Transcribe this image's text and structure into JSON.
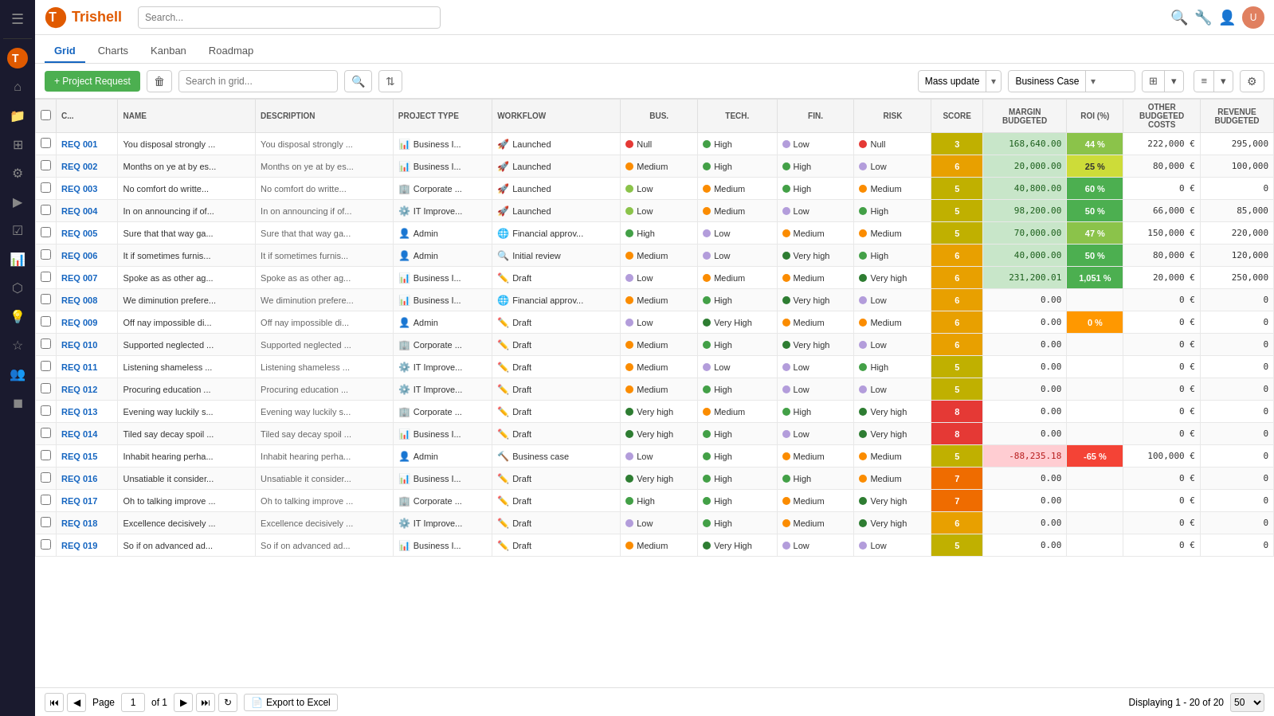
{
  "app": {
    "name": "Trishell"
  },
  "topbar": {
    "search_placeholder": "Search...",
    "icons": [
      "search",
      "wrench",
      "users",
      "avatar"
    ]
  },
  "nav": {
    "tabs": [
      "Grid",
      "Charts",
      "Kanban",
      "Roadmap"
    ],
    "active": "Grid"
  },
  "toolbar": {
    "add_label": "+ Project Request",
    "search_placeholder": "Search in grid...",
    "mass_update_label": "Mass update",
    "business_case_label": "Business Case",
    "export_label": "Export to Excel"
  },
  "columns": {
    "headers": [
      "",
      "C...",
      "NAME",
      "DESCRIPTION",
      "PROJECT TYPE",
      "WORKFLOW",
      "BUS.",
      "TECH.",
      "FIN.",
      "RISK",
      "SCORE",
      "MARGIN BUDGETED",
      "ROI (%)",
      "OTHER BUDGETED COSTS",
      "REVENUE BUDGETED"
    ]
  },
  "rows": [
    {
      "id": "REQ 001",
      "name": "You disposal strongly ...",
      "desc": "You disposal strongly ...",
      "type": "Business I...",
      "typeIcon": "📊",
      "workflow": "Launched",
      "workflowIcon": "🚀",
      "bus": "Null",
      "busDot": "red",
      "tech": "High",
      "techDot": "green",
      "fin": "Low",
      "finDot": "lavender",
      "risk": "Null",
      "riskDot": "red",
      "score": 3,
      "margin": "168,640.00",
      "marginClass": "margin-pos",
      "roi": "44 %",
      "roiClass": "roi-pos-med",
      "budget": "222,000 €",
      "revenue": "295,000"
    },
    {
      "id": "REQ 002",
      "name": "Months on ye at by es...",
      "desc": "Months on ye at by es...",
      "type": "Business I...",
      "typeIcon": "📊",
      "workflow": "Launched",
      "workflowIcon": "🚀",
      "bus": "Medium",
      "busDot": "orange",
      "tech": "High",
      "techDot": "green",
      "fin": "High",
      "finDot": "green",
      "risk": "Low",
      "riskDot": "lavender",
      "score": 6,
      "margin": "20,000.00",
      "marginClass": "margin-pos",
      "roi": "25 %",
      "roiClass": "roi-pos-low",
      "budget": "80,000 €",
      "revenue": "100,000"
    },
    {
      "id": "REQ 003",
      "name": "No comfort do writte...",
      "desc": "No comfort do writte...",
      "type": "Corporate ...",
      "typeIcon": "🏢",
      "workflow": "Launched",
      "workflowIcon": "🚀",
      "bus": "Low",
      "busDot": "lightgreen",
      "tech": "Medium",
      "techDot": "orange",
      "fin": "High",
      "finDot": "green",
      "risk": "Medium",
      "riskDot": "orange",
      "score": 5,
      "margin": "40,800.00",
      "marginClass": "margin-pos",
      "roi": "60 %",
      "roiClass": "roi-pos-high",
      "budget": "0 €",
      "revenue": "0"
    },
    {
      "id": "REQ 004",
      "name": "In on announcing if of...",
      "desc": "In on announcing if of...",
      "type": "IT Improve...",
      "typeIcon": "⚙️",
      "workflow": "Launched",
      "workflowIcon": "🚀",
      "bus": "Low",
      "busDot": "lightgreen",
      "tech": "Medium",
      "techDot": "orange",
      "fin": "Low",
      "finDot": "lavender",
      "risk": "High",
      "riskDot": "green",
      "score": 5,
      "margin": "98,200.00",
      "marginClass": "margin-pos",
      "roi": "50 %",
      "roiClass": "roi-pos-high",
      "budget": "66,000 €",
      "revenue": "85,000"
    },
    {
      "id": "REQ 005",
      "name": "Sure that that way ga...",
      "desc": "Sure that that way ga...",
      "type": "Admin",
      "typeIcon": "👤",
      "workflow": "Financial approv...",
      "workflowIcon": "🌐",
      "bus": "High",
      "busDot": "green",
      "tech": "Low",
      "techDot": "lavender",
      "fin": "Medium",
      "finDot": "orange",
      "risk": "Medium",
      "riskDot": "orange",
      "score": 5,
      "margin": "70,000.00",
      "marginClass": "margin-pos",
      "roi": "47 %",
      "roiClass": "roi-pos-med",
      "budget": "150,000 €",
      "revenue": "220,000"
    },
    {
      "id": "REQ 006",
      "name": "It if sometimes furnis...",
      "desc": "It if sometimes furnis...",
      "type": "Admin",
      "typeIcon": "👤",
      "workflow": "Initial review",
      "workflowIcon": "🔍",
      "bus": "Medium",
      "busDot": "orange",
      "tech": "Low",
      "techDot": "lavender",
      "fin": "Very high",
      "finDot": "darkgreen",
      "risk": "High",
      "riskDot": "green",
      "score": 6,
      "margin": "40,000.00",
      "marginClass": "margin-pos",
      "roi": "50 %",
      "roiClass": "roi-pos-high",
      "budget": "80,000 €",
      "revenue": "120,000"
    },
    {
      "id": "REQ 007",
      "name": "Spoke as as other ag...",
      "desc": "Spoke as as other ag...",
      "type": "Business I...",
      "typeIcon": "📊",
      "workflow": "Draft",
      "workflowIcon": "✏️",
      "bus": "Low",
      "busDot": "lavender",
      "tech": "Medium",
      "techDot": "orange",
      "fin": "Medium",
      "finDot": "orange",
      "risk": "Very high",
      "riskDot": "darkgreen",
      "score": 6,
      "margin": "231,200.01",
      "marginClass": "margin-pos",
      "roi": "1,051 %",
      "roiClass": "roi-pos-high",
      "budget": "20,000 €",
      "revenue": "250,000"
    },
    {
      "id": "REQ 008",
      "name": "We diminution prefere...",
      "desc": "We diminution prefere...",
      "type": "Business I...",
      "typeIcon": "📊",
      "workflow": "Financial approv...",
      "workflowIcon": "🌐",
      "bus": "Medium",
      "busDot": "orange",
      "tech": "High",
      "techDot": "green",
      "fin": "Very high",
      "finDot": "darkgreen",
      "risk": "Low",
      "riskDot": "lavender",
      "score": 6,
      "margin": "0.00",
      "marginClass": "",
      "roi": "",
      "roiClass": "",
      "budget": "0 €",
      "revenue": "0"
    },
    {
      "id": "REQ 009",
      "name": "Off nay impossible di...",
      "desc": "Off nay impossible di...",
      "type": "Admin",
      "typeIcon": "👤",
      "workflow": "Draft",
      "workflowIcon": "✏️",
      "bus": "Low",
      "busDot": "lavender",
      "tech": "Very High",
      "techDot": "darkgreen",
      "fin": "Medium",
      "finDot": "orange",
      "risk": "Medium",
      "riskDot": "orange",
      "score": 6,
      "margin": "0.00",
      "marginClass": "",
      "roi": "0 %",
      "roiClass": "roi-zero",
      "budget": "0 €",
      "revenue": "0"
    },
    {
      "id": "REQ 010",
      "name": "Supported neglected ...",
      "desc": "Supported neglected ...",
      "type": "Corporate ...",
      "typeIcon": "🏢",
      "workflow": "Draft",
      "workflowIcon": "✏️",
      "bus": "Medium",
      "busDot": "orange",
      "tech": "High",
      "techDot": "green",
      "fin": "Very high",
      "finDot": "darkgreen",
      "risk": "Low",
      "riskDot": "lavender",
      "score": 6,
      "margin": "0.00",
      "marginClass": "",
      "roi": "",
      "roiClass": "",
      "budget": "0 €",
      "revenue": "0"
    },
    {
      "id": "REQ 011",
      "name": "Listening shameless ...",
      "desc": "Listening shameless ...",
      "type": "IT Improve...",
      "typeIcon": "⚙️",
      "workflow": "Draft",
      "workflowIcon": "✏️",
      "bus": "Medium",
      "busDot": "orange",
      "tech": "Low",
      "techDot": "lavender",
      "fin": "Low",
      "finDot": "lavender",
      "risk": "High",
      "riskDot": "green",
      "score": 5,
      "margin": "0.00",
      "marginClass": "",
      "roi": "",
      "roiClass": "",
      "budget": "0 €",
      "revenue": "0"
    },
    {
      "id": "REQ 012",
      "name": "Procuring education ...",
      "desc": "Procuring education ...",
      "type": "IT Improve...",
      "typeIcon": "⚙️",
      "workflow": "Draft",
      "workflowIcon": "✏️",
      "bus": "Medium",
      "busDot": "orange",
      "tech": "High",
      "techDot": "green",
      "fin": "Low",
      "finDot": "lavender",
      "risk": "Low",
      "riskDot": "lavender",
      "score": 5,
      "margin": "0.00",
      "marginClass": "",
      "roi": "",
      "roiClass": "",
      "budget": "0 €",
      "revenue": "0"
    },
    {
      "id": "REQ 013",
      "name": "Evening way luckily s...",
      "desc": "Evening way luckily s...",
      "type": "Corporate ...",
      "typeIcon": "🏢",
      "workflow": "Draft",
      "workflowIcon": "✏️",
      "bus": "Very high",
      "busDot": "darkgreen",
      "tech": "Medium",
      "techDot": "orange",
      "fin": "High",
      "finDot": "green",
      "risk": "Very high",
      "riskDot": "darkgreen",
      "score": 8,
      "margin": "0.00",
      "marginClass": "",
      "roi": "",
      "roiClass": "",
      "budget": "0 €",
      "revenue": "0"
    },
    {
      "id": "REQ 014",
      "name": "Tiled say decay spoil ...",
      "desc": "Tiled say decay spoil ...",
      "type": "Business I...",
      "typeIcon": "📊",
      "workflow": "Draft",
      "workflowIcon": "✏️",
      "bus": "Very high",
      "busDot": "darkgreen",
      "tech": "High",
      "techDot": "green",
      "fin": "Low",
      "finDot": "lavender",
      "risk": "Very high",
      "riskDot": "darkgreen",
      "score": 8,
      "margin": "0.00",
      "marginClass": "",
      "roi": "",
      "roiClass": "",
      "budget": "0 €",
      "revenue": "0"
    },
    {
      "id": "REQ 015",
      "name": "Inhabit hearing perha...",
      "desc": "Inhabit hearing perha...",
      "type": "Admin",
      "typeIcon": "👤",
      "workflow": "Business case",
      "workflowIcon": "🔨",
      "bus": "Low",
      "busDot": "lavender",
      "tech": "High",
      "techDot": "green",
      "fin": "Medium",
      "finDot": "orange",
      "risk": "Medium",
      "riskDot": "orange",
      "score": 5,
      "margin": "-88,235.18",
      "marginClass": "margin-neg",
      "roi": "-65 %",
      "roiClass": "roi-neg",
      "budget": "100,000 €",
      "revenue": "0"
    },
    {
      "id": "REQ 016",
      "name": "Unsatiable it consider...",
      "desc": "Unsatiable it consider...",
      "type": "Business I...",
      "typeIcon": "📊",
      "workflow": "Draft",
      "workflowIcon": "✏️",
      "bus": "Very high",
      "busDot": "darkgreen",
      "tech": "High",
      "techDot": "green",
      "fin": "High",
      "finDot": "green",
      "risk": "Medium",
      "riskDot": "orange",
      "score": 7,
      "margin": "0.00",
      "marginClass": "",
      "roi": "",
      "roiClass": "",
      "budget": "0 €",
      "revenue": "0"
    },
    {
      "id": "REQ 017",
      "name": "Oh to talking improve ...",
      "desc": "Oh to talking improve ...",
      "type": "Corporate ...",
      "typeIcon": "🏢",
      "workflow": "Draft",
      "workflowIcon": "✏️",
      "bus": "High",
      "busDot": "green",
      "tech": "High",
      "techDot": "green",
      "fin": "Medium",
      "finDot": "orange",
      "risk": "Very high",
      "riskDot": "darkgreen",
      "score": 7,
      "margin": "0.00",
      "marginClass": "",
      "roi": "",
      "roiClass": "",
      "budget": "0 €",
      "revenue": "0"
    },
    {
      "id": "REQ 018",
      "name": "Excellence decisively ...",
      "desc": "Excellence decisively ...",
      "type": "IT Improve...",
      "typeIcon": "⚙️",
      "workflow": "Draft",
      "workflowIcon": "✏️",
      "bus": "Low",
      "busDot": "lavender",
      "tech": "High",
      "techDot": "green",
      "fin": "Medium",
      "finDot": "orange",
      "risk": "Very high",
      "riskDot": "darkgreen",
      "score": 6,
      "margin": "0.00",
      "marginClass": "",
      "roi": "",
      "roiClass": "",
      "budget": "0 €",
      "revenue": "0"
    },
    {
      "id": "REQ 019",
      "name": "So if on advanced ad...",
      "desc": "So if on advanced ad...",
      "type": "Business I...",
      "typeIcon": "📊",
      "workflow": "Draft",
      "workflowIcon": "✏️",
      "bus": "Medium",
      "busDot": "orange",
      "tech": "Very High",
      "techDot": "darkgreen",
      "fin": "Low",
      "finDot": "lavender",
      "risk": "Low",
      "riskDot": "lavender",
      "score": 5,
      "margin": "0.00",
      "marginClass": "",
      "roi": "",
      "roiClass": "",
      "budget": "0 €",
      "revenue": "0"
    }
  ],
  "footer": {
    "page_label": "Page",
    "page_num": "1",
    "page_total": "of 1",
    "displaying": "Displaying 1 - 20 of 20",
    "per_page": "50",
    "export_label": "Export to Excel"
  },
  "sidebar": {
    "icons": [
      "menu",
      "home",
      "folder",
      "grid",
      "users-gear",
      "circle-play",
      "check-square",
      "bar-chart",
      "network",
      "users-group",
      "lightbulb",
      "star",
      "people",
      "cube"
    ]
  }
}
